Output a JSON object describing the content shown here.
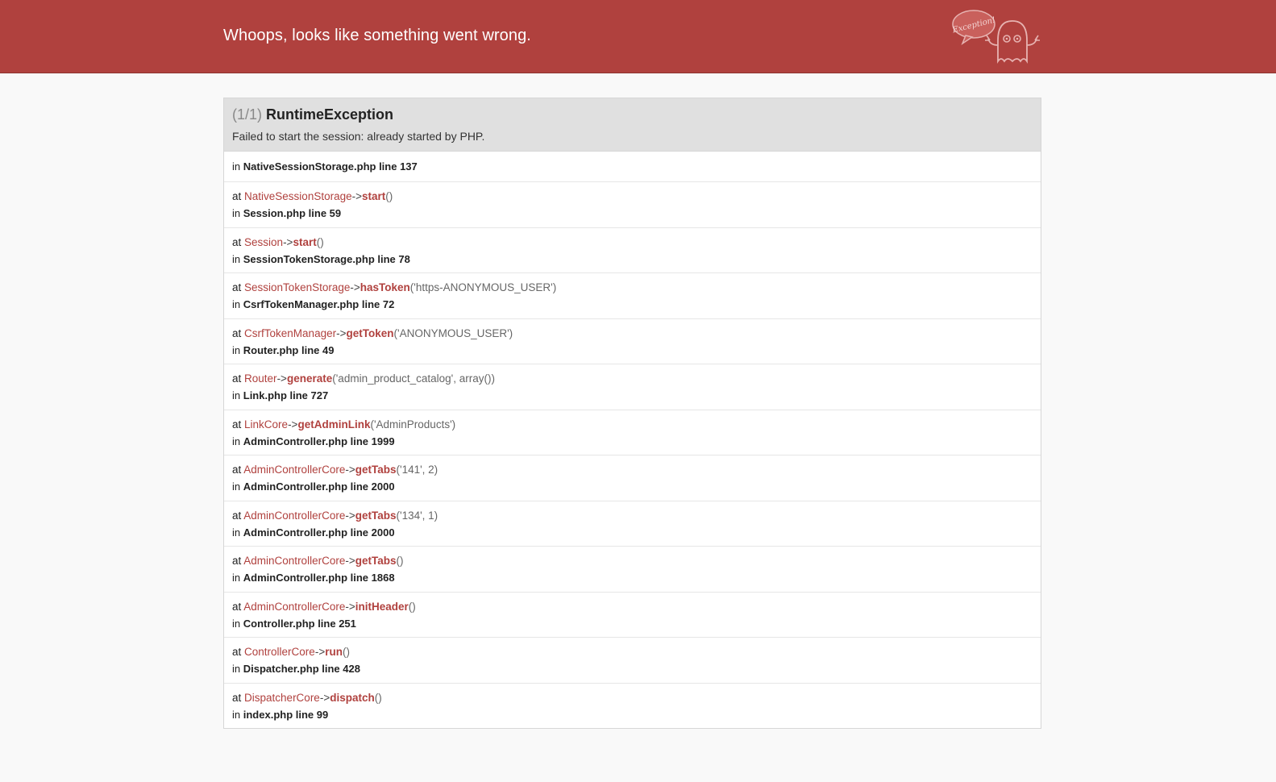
{
  "header": {
    "title": "Whoops, looks like something went wrong.",
    "badge": "Exception!"
  },
  "exception": {
    "count": "(1/1)",
    "class": "RuntimeException",
    "message": "Failed to start the session: already started by PHP.",
    "origin": {
      "in": "in",
      "file": "NativeSessionStorage.php line 137"
    }
  },
  "trace": [
    {
      "at": "at",
      "class": "NativeSessionStorage",
      "arrow": "->",
      "method": "start",
      "args": "()",
      "in": "in",
      "file": "Session.php line 59"
    },
    {
      "at": "at",
      "class": "Session",
      "arrow": "->",
      "method": "start",
      "args": "()",
      "in": "in",
      "file": "SessionTokenStorage.php line 78"
    },
    {
      "at": "at",
      "class": "SessionTokenStorage",
      "arrow": "->",
      "method": "hasToken",
      "args": "('https-ANONYMOUS_USER')",
      "in": "in",
      "file": "CsrfTokenManager.php line 72"
    },
    {
      "at": "at",
      "class": "CsrfTokenManager",
      "arrow": "->",
      "method": "getToken",
      "args": "('ANONYMOUS_USER')",
      "in": "in",
      "file": "Router.php line 49"
    },
    {
      "at": "at",
      "class": "Router",
      "arrow": "->",
      "method": "generate",
      "args": "('admin_product_catalog', array())",
      "in": "in",
      "file": "Link.php line 727"
    },
    {
      "at": "at",
      "class": "LinkCore",
      "arrow": "->",
      "method": "getAdminLink",
      "args": "('AdminProducts')",
      "in": "in",
      "file": "AdminController.php line 1999"
    },
    {
      "at": "at",
      "class": "AdminControllerCore",
      "arrow": "->",
      "method": "getTabs",
      "args": "('141', 2)",
      "in": "in",
      "file": "AdminController.php line 2000"
    },
    {
      "at": "at",
      "class": "AdminControllerCore",
      "arrow": "->",
      "method": "getTabs",
      "args": "('134', 1)",
      "in": "in",
      "file": "AdminController.php line 2000"
    },
    {
      "at": "at",
      "class": "AdminControllerCore",
      "arrow": "->",
      "method": "getTabs",
      "args": "()",
      "in": "in",
      "file": "AdminController.php line 1868"
    },
    {
      "at": "at",
      "class": "AdminControllerCore",
      "arrow": "->",
      "method": "initHeader",
      "args": "()",
      "in": "in",
      "file": "Controller.php line 251"
    },
    {
      "at": "at",
      "class": "ControllerCore",
      "arrow": "->",
      "method": "run",
      "args": "()",
      "in": "in",
      "file": "Dispatcher.php line 428"
    },
    {
      "at": "at",
      "class": "DispatcherCore",
      "arrow": "->",
      "method": "dispatch",
      "args": "()",
      "in": "in",
      "file": "index.php line 99"
    }
  ],
  "colors": {
    "header_bg": "#b0413e",
    "accent": "#b0413e",
    "page_bg": "#f9f9f9"
  }
}
